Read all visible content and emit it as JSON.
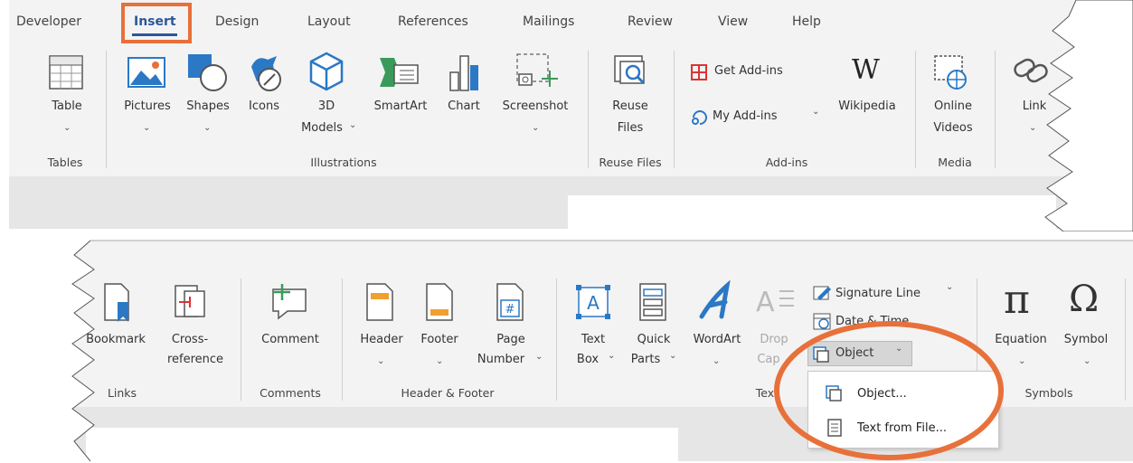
{
  "top_ribbon": {
    "tabs": [
      "Developer",
      "Insert",
      "Design",
      "Layout",
      "References",
      "Mailings",
      "Review",
      "View",
      "Help"
    ],
    "active_tab": "Insert",
    "buttons": {
      "table": "Table",
      "pictures": "Pictures",
      "shapes": "Shapes",
      "icons": "Icons",
      "models_line1": "3D",
      "models_line2": "Models",
      "smartart": "SmartArt",
      "chart": "Chart",
      "screenshot": "Screenshot",
      "reuse_line1": "Reuse",
      "reuse_line2": "Files",
      "get_addins": "Get Add-ins",
      "my_addins": "My Add-ins",
      "wikipedia": "Wikipedia",
      "wikipedia_glyph": "W",
      "online_line1": "Online",
      "online_line2": "Videos",
      "link": "Link"
    },
    "groups": {
      "tables": "Tables",
      "illustrations": "Illustrations",
      "reuse_files": "Reuse Files",
      "addins": "Add-ins",
      "media": "Media"
    }
  },
  "bottom_ribbon": {
    "buttons": {
      "bookmark": "Bookmark",
      "cross_line1": "Cross-",
      "cross_line2": "reference",
      "comment": "Comment",
      "header": "Header",
      "footer": "Footer",
      "page_line1": "Page",
      "page_line2": "Number",
      "textbox_line1": "Text",
      "textbox_line2": "Box",
      "quick_line1": "Quick",
      "quick_line2": "Parts",
      "wordart": "WordArt",
      "drop_line1": "Drop",
      "drop_line2": "Cap",
      "signature_line": "Signature Line",
      "date_time": "Date & Time",
      "object": "Object",
      "equation": "Equation",
      "symbol": "Symbol",
      "pi_glyph": "π",
      "omega_glyph": "Ω"
    },
    "groups": {
      "links": "Links",
      "comments": "Comments",
      "header_footer": "Header & Footer",
      "text": "Tex",
      "symbols": "Symbols"
    },
    "object_menu": {
      "items": [
        "Object...",
        "Text from File..."
      ]
    }
  },
  "colors": {
    "highlight_orange": "#E8703A",
    "ribbon_bg": "#F3F3F3",
    "active_tab_underline": "#2B579A",
    "icon_blue": "#2B78C5"
  }
}
